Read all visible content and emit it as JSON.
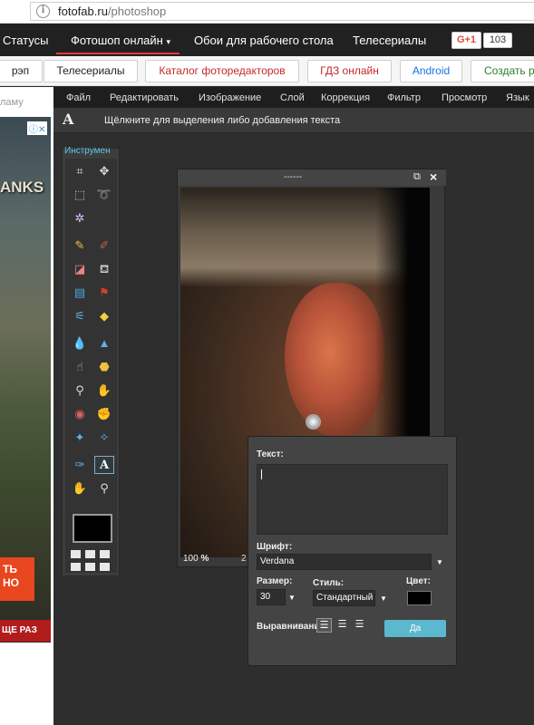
{
  "browser": {
    "url_host": "fotofab.ru",
    "url_path": "/photoshop"
  },
  "sitenav": {
    "items": [
      "Статусы",
      "Фотошоп онлайн",
      "Обои для рабочего стола",
      "Телесериалы"
    ],
    "gplus_label": "G+1",
    "gplus_count": "103"
  },
  "pills": [
    "рэп",
    "Телесериалы",
    "Каталог фоторедакторов",
    "ГДЗ онлайн",
    "Android",
    "Создать р"
  ],
  "leftcol": {
    "label": "ламу",
    "ad_tanks": "ANKS",
    "ad_cta": "ТЬ НО",
    "ad_bottom": "ЩЕ РАЗ"
  },
  "app": {
    "menu": [
      "Файл",
      "Редактировать",
      "Изображение",
      "Слой",
      "Коррекция",
      "Фильтр",
      "Просмотр",
      "Язык"
    ],
    "tool_hint": "Щёлкните для выделения либо добавления текста",
    "tools_title": "Инструмен",
    "image_title": "------",
    "zoom_value": "100",
    "zoom_unit": "%",
    "zoom_extra": "2"
  },
  "text_dialog": {
    "text_label": "Текст:",
    "font_label": "Шрифт:",
    "font_value": "Verdana",
    "size_label": "Размер:",
    "size_value": "30",
    "style_label": "Стиль:",
    "style_value": "Стандартный",
    "color_label": "Цвет:",
    "color_value": "#000000",
    "align_label": "Выравнивани",
    "ok_label": "Да"
  },
  "colors": {
    "accent_blue": "#5bb8cf",
    "nav_active": "#e53935",
    "pill_red": "#c62828",
    "pill_blue": "#1a73e8",
    "pill_green": "#2e7d32"
  }
}
